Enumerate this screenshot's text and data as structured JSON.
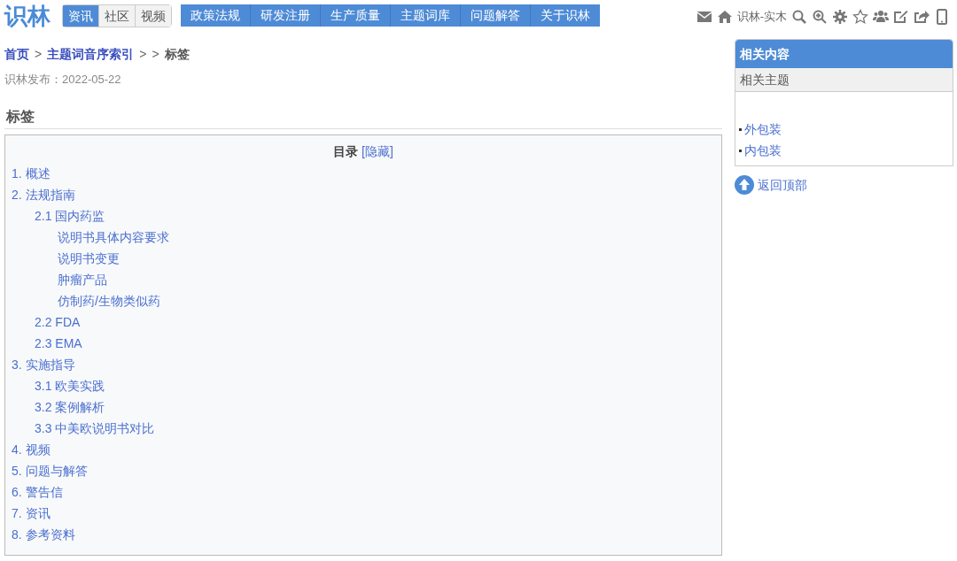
{
  "logo": "识林",
  "tabs": [
    {
      "label": "资讯",
      "selected": true
    },
    {
      "label": "社区",
      "selected": false
    },
    {
      "label": "视频",
      "selected": false
    }
  ],
  "nav": [
    "政策法规",
    "研发注册",
    "生产质量",
    "主题词库",
    "问题解答",
    "关于识林"
  ],
  "toolbar": {
    "user": "识林-实木"
  },
  "breadcrumb": [
    {
      "label": "首页",
      "kind": "link"
    },
    {
      "label": ">",
      "kind": "separator"
    },
    {
      "label": "主题词音序索引",
      "kind": "link"
    },
    {
      "label": ">",
      "kind": "separator"
    },
    {
      "label": ">",
      "kind": "separator"
    },
    {
      "label": "标签",
      "kind": "current"
    }
  ],
  "published": "识林发布：2022-05-22",
  "heading": "标签",
  "toc": {
    "title": "目录",
    "toggle": "[隐藏]",
    "items": [
      {
        "label": "1. 概述"
      },
      {
        "label": "2. 法规指南",
        "children": [
          {
            "label": "2.1 国内药监",
            "children": [
              {
                "label": "说明书具体内容要求"
              },
              {
                "label": "说明书变更"
              },
              {
                "label": "肿瘤产品"
              },
              {
                "label": "仿制药/生物类似药"
              }
            ]
          },
          {
            "label": "2.2 FDA"
          },
          {
            "label": "2.3 EMA"
          }
        ]
      },
      {
        "label": "3. 实施指导",
        "children": [
          {
            "label": "3.1 欧美实践"
          },
          {
            "label": "3.2 案例解析"
          },
          {
            "label": "3.3 中美欧说明书对比"
          }
        ]
      },
      {
        "label": "4. 视频"
      },
      {
        "label": "5. 问题与解答"
      },
      {
        "label": "6. 警告信"
      },
      {
        "label": "7. 资讯"
      },
      {
        "label": "8. 参考资料"
      }
    ]
  },
  "sidebar": {
    "title": "相关内容",
    "subtitle": "相关主题",
    "links": [
      "外包装",
      "内包装"
    ],
    "back_to_top": "返回顶部"
  }
}
